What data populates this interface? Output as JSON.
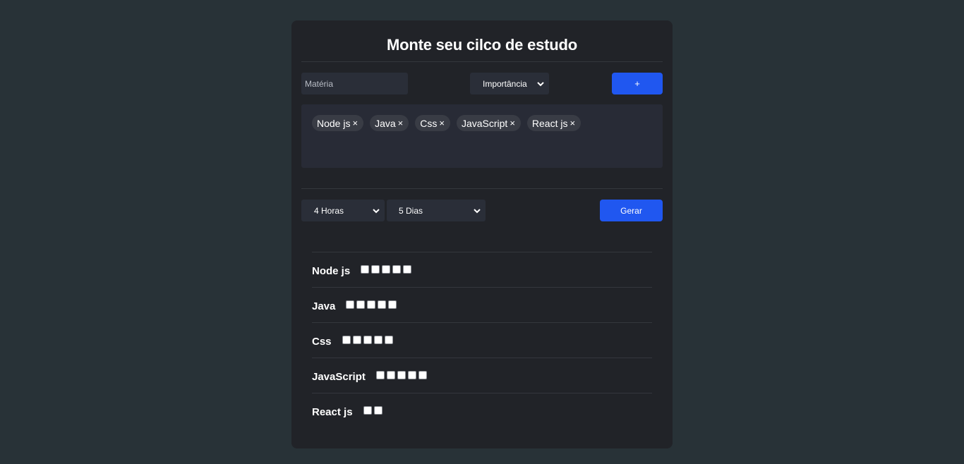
{
  "header": {
    "title": "Monte seu cilco de estudo"
  },
  "form": {
    "subject_placeholder": "Matéria",
    "importance_selected": "Importância",
    "add_button_label": "+"
  },
  "tags": [
    {
      "label": "Node js",
      "remove": "×"
    },
    {
      "label": "Java",
      "remove": "×"
    },
    {
      "label": "Css",
      "remove": "×"
    },
    {
      "label": "JavaScript",
      "remove": "×"
    },
    {
      "label": "React js",
      "remove": "×"
    }
  ],
  "settings": {
    "hours_selected": "4 Horas",
    "days_selected": "5 Dias",
    "generate_button_label": "Gerar"
  },
  "schedule": [
    {
      "subject": "Node js",
      "checkbox_count": 5
    },
    {
      "subject": "Java",
      "checkbox_count": 5
    },
    {
      "subject": "Css",
      "checkbox_count": 5
    },
    {
      "subject": "JavaScript",
      "checkbox_count": 5
    },
    {
      "subject": "React js",
      "checkbox_count": 2
    }
  ],
  "colors": {
    "background": "#283237",
    "card": "#212328",
    "accent": "#2057f0",
    "tag": "#393c45"
  }
}
